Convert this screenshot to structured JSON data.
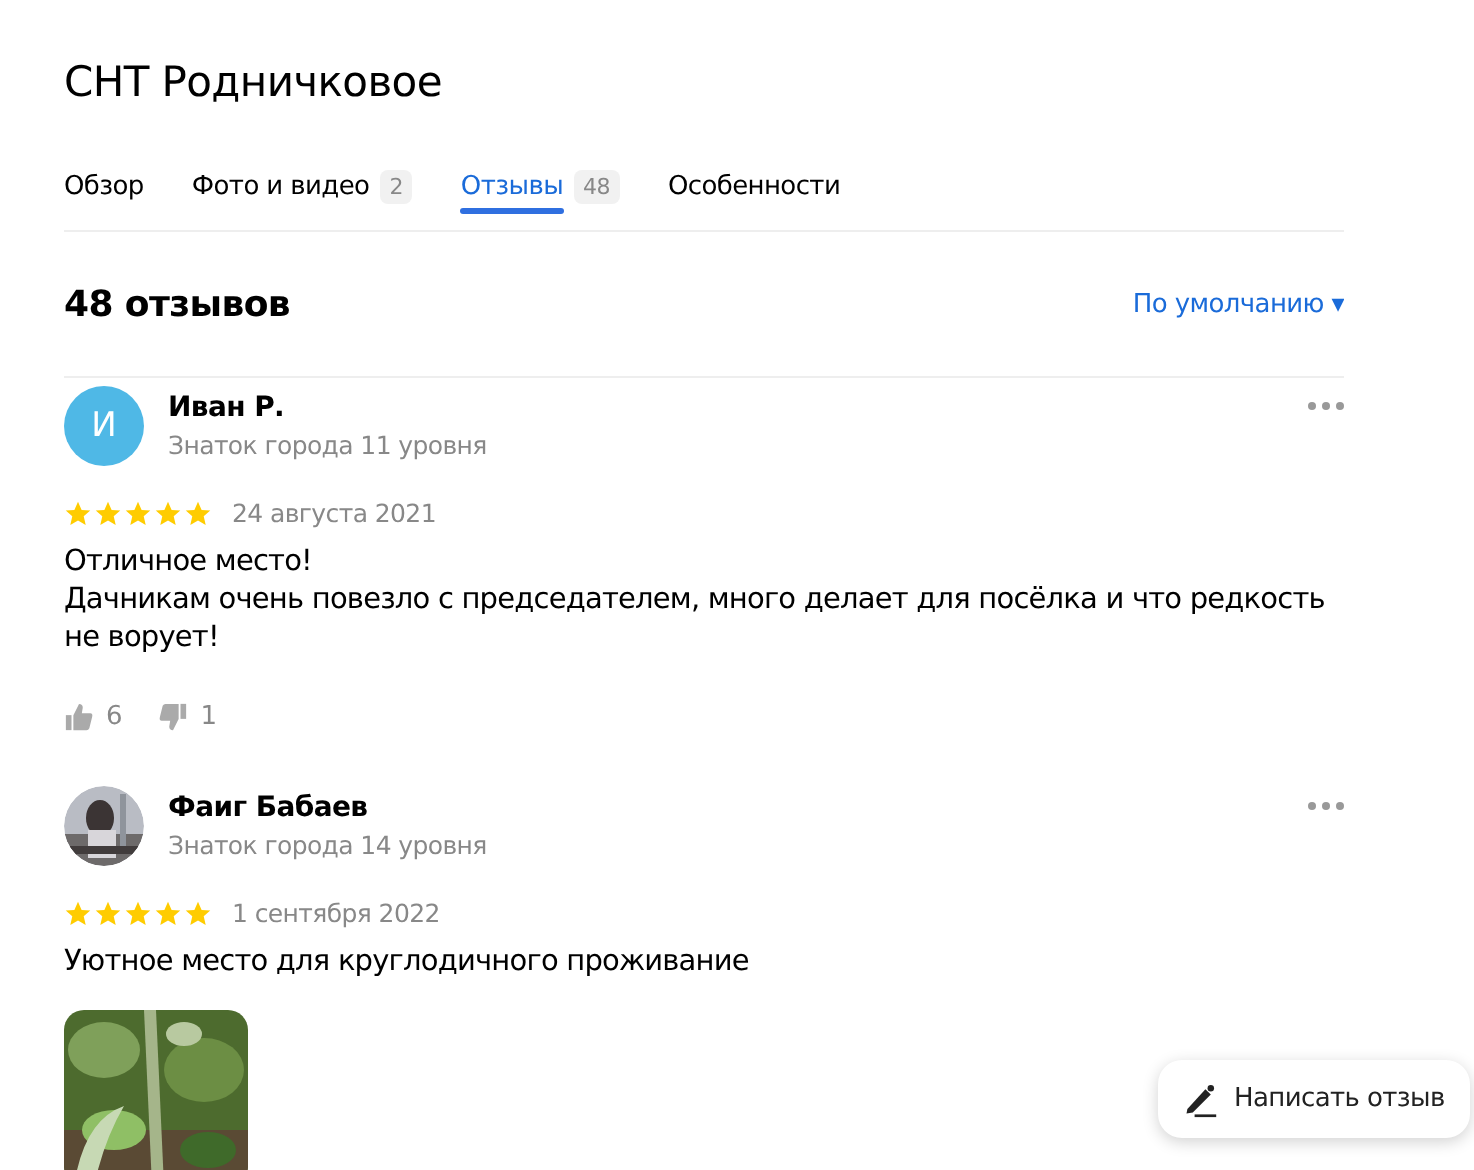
{
  "title": "СНТ Родничковое",
  "tabs": [
    {
      "label": "Обзор",
      "selected": false
    },
    {
      "label": "Фото и видео",
      "count": "2",
      "selected": false
    },
    {
      "label": "Отзывы",
      "count": "48",
      "selected": true
    },
    {
      "label": "Особенности",
      "selected": false
    }
  ],
  "reviews_heading": "48 отзывов",
  "sort": {
    "label": "По умолчанию",
    "caret": "▾"
  },
  "reviews": [
    {
      "avatar": {
        "kind": "letter",
        "letter": "И",
        "color": "#4fb8e6"
      },
      "name": "Иван Р.",
      "level": "Знаток города 11 уровня",
      "stars": 5,
      "date": "24 августа 2021",
      "text": [
        "Отличное место!",
        "Дачникам очень повезло с председателем, много делает для посёлка и что редкость не ворует!"
      ],
      "likes": "6",
      "dislikes": "1"
    },
    {
      "avatar": {
        "kind": "picture"
      },
      "name": "Фаиг Бабаев",
      "level": "Знаток города 14 уровня",
      "stars": 5,
      "date": "1 сентября 2022",
      "text": [
        "Уютное место для круглодичного проживание"
      ],
      "photos": [
        {
          "kind": "picture"
        }
      ]
    }
  ],
  "write_button": "Написать отзыв"
}
